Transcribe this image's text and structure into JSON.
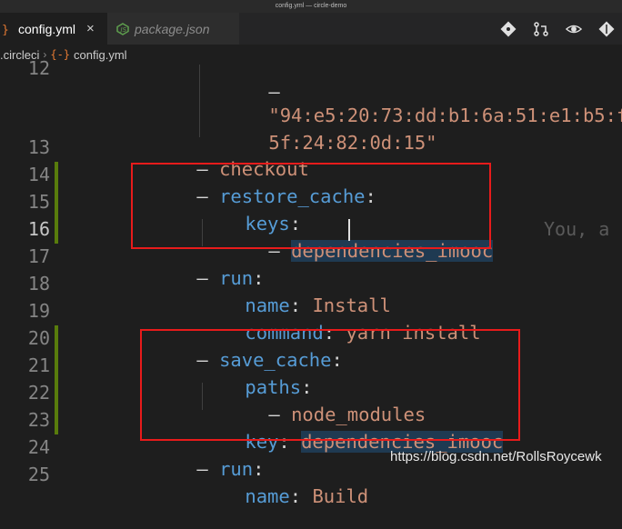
{
  "window": {
    "title": "config.yml — circle-demo"
  },
  "tabs": [
    {
      "label": "config.yml",
      "close": "×"
    },
    {
      "label": "package.json"
    }
  ],
  "breadcrumb": {
    "folder": ".circleci",
    "file": "config.yml",
    "sep": "›"
  },
  "lines": {
    "l12": "12",
    "l13": "13",
    "l14": "14",
    "l15": "15",
    "l16": "16",
    "l17": "17",
    "l18": "18",
    "l19": "19",
    "l20": "20",
    "l21": "21",
    "l22": "22",
    "l23": "23",
    "l24": "24",
    "l25": "25"
  },
  "code": {
    "fp_dash": "–",
    "fp_line1": "\"94:e5:20:73:dd:b1:6a:51:e1:b5:fb",
    "fp_line2": "5f:24:82:0d:15\"",
    "checkout": "checkout",
    "restore_cache": "restore_cache",
    "keys": "keys",
    "dep1_a": "dependen",
    "dep1_b": "cies_imooc",
    "run1": "run",
    "name_key": "name",
    "name_val": "Install",
    "command_key": "command",
    "command_val": "yarn install",
    "save_cache": "save_cache",
    "paths": "paths",
    "node_modules": "node_modules",
    "key_key": "key",
    "key_val": "dependencies_imooc",
    "run2": "run",
    "name2_key": "name",
    "name2_val": "Build"
  },
  "ghost_text": "You, a",
  "watermark": "https://blog.csdn.net/RollsRoycewk",
  "colors": {
    "highlight_box": "#e81b1b",
    "git_modified": "#587c0c"
  }
}
